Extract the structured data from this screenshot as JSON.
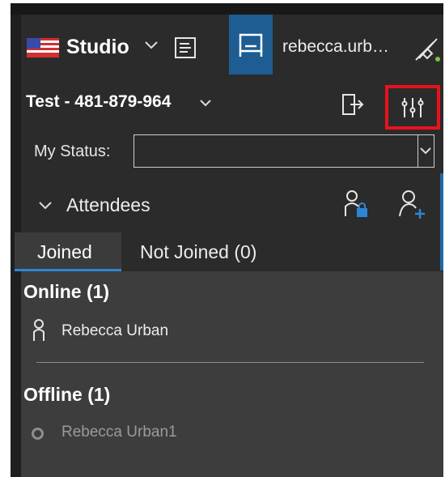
{
  "header": {
    "mode_label": "Studio",
    "username": "rebecca.urb…",
    "icons": [
      "us-flag-icon",
      "chevron-down-icon",
      "notes-icon",
      "whiteboard-icon",
      "plug-icon"
    ]
  },
  "meeting": {
    "title": "Test - 481-879-964",
    "icons": [
      "chevron-down-icon",
      "leave-icon",
      "settings-sliders-icon"
    ]
  },
  "status": {
    "label": "My Status:",
    "value": ""
  },
  "attendees": {
    "label": "Attendees",
    "icons": [
      "chevron-down-icon",
      "lock-attendee-icon",
      "add-attendee-icon"
    ]
  },
  "tabs": [
    {
      "label": "Joined",
      "active": true
    },
    {
      "label": "Not Joined (0)",
      "active": false
    }
  ],
  "online": {
    "heading": "Online (1)",
    "people": [
      "Rebecca Urban"
    ]
  },
  "offline": {
    "heading": "Offline (1)",
    "people": [
      "Rebecca Urban1"
    ]
  },
  "colors": {
    "panel": "#2b2b2b",
    "list_bg": "#3d3d3d",
    "accent_blue": "#1d5d92",
    "tab_underline": "#2d86d3",
    "highlight_red": "#e8121c"
  }
}
